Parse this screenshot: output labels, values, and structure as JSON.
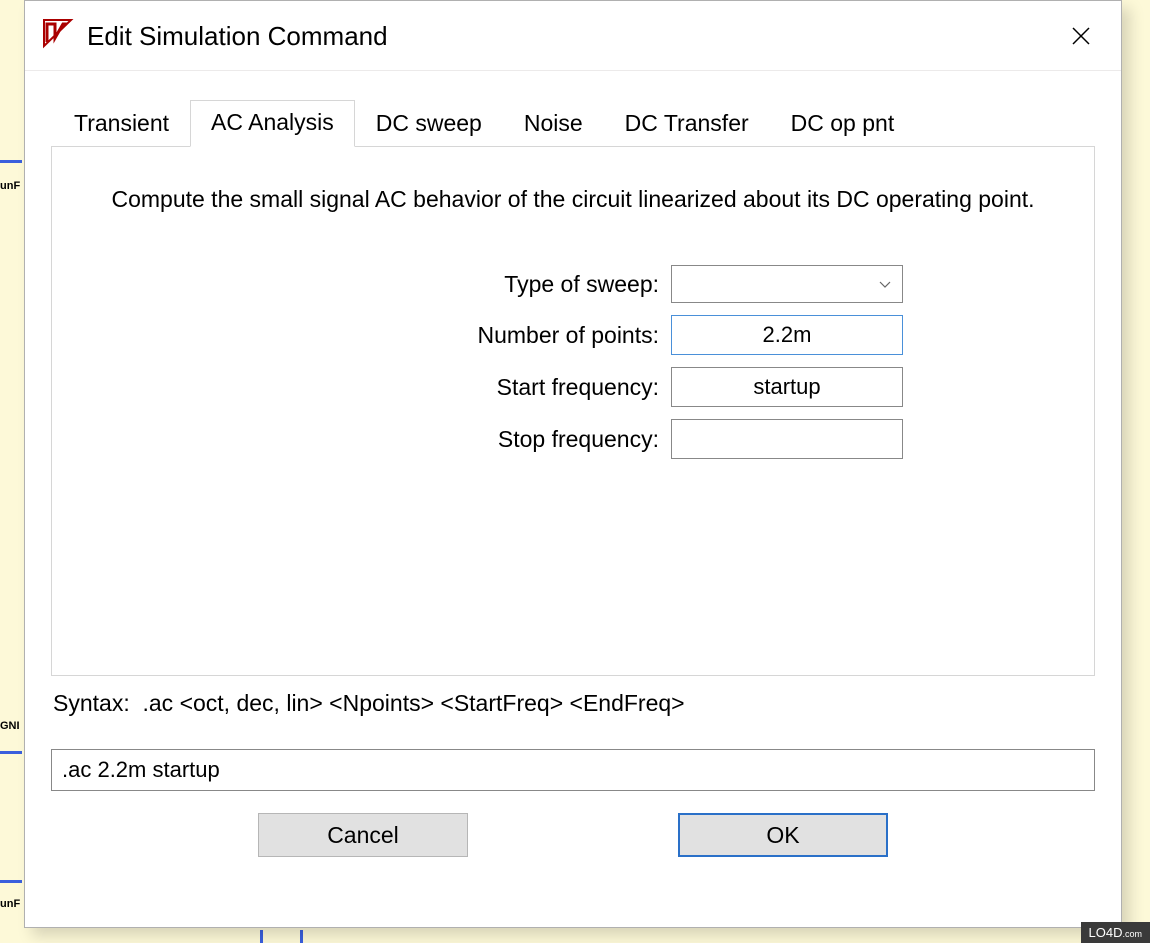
{
  "dialog": {
    "title": "Edit Simulation Command"
  },
  "tabs": {
    "items": [
      {
        "label": "Transient",
        "active": false
      },
      {
        "label": "AC Analysis",
        "active": true
      },
      {
        "label": "DC sweep",
        "active": false
      },
      {
        "label": "Noise",
        "active": false
      },
      {
        "label": "DC Transfer",
        "active": false
      },
      {
        "label": "DC op pnt",
        "active": false
      }
    ]
  },
  "ac_analysis": {
    "description": "Compute the small signal AC behavior of the circuit linearized about its DC operating point.",
    "fields": {
      "type_of_sweep_label": "Type of sweep:",
      "type_of_sweep_value": "",
      "number_of_points_label": "Number of points:",
      "number_of_points_value": "2.2m",
      "start_frequency_label": "Start frequency:",
      "start_frequency_value": "startup",
      "stop_frequency_label": "Stop frequency:",
      "stop_frequency_value": ""
    }
  },
  "syntax": {
    "label": "Syntax:",
    "text": ".ac <oct, dec, lin> <Npoints> <StartFreq> <EndFreq>"
  },
  "command_line": ".ac 2.2m startup",
  "buttons": {
    "cancel": "Cancel",
    "ok": "OK"
  },
  "watermark": {
    "brand": "LO4D",
    "suffix": ".com"
  }
}
